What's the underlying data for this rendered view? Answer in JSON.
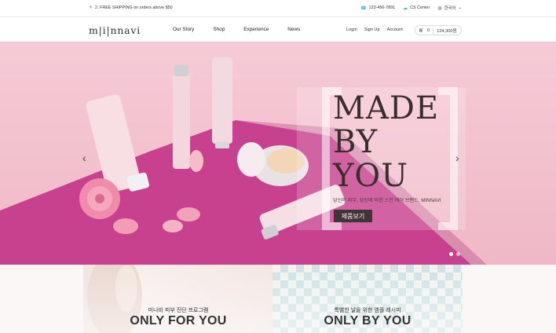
{
  "topbar": {
    "promo_icon": "airplane-icon",
    "promo_text": "2. FREE SHIPPING on orders above $50",
    "phone": "123-456-7891",
    "cs_center": "CS Center",
    "language": "한국어"
  },
  "header": {
    "logo": "m|i|nnavi",
    "nav": [
      "Our Story",
      "Shop",
      "Experience",
      "News"
    ],
    "account_links": [
      "Login",
      "Sign Up",
      "Account"
    ],
    "cart_count": "0",
    "cart_total": "124,300원"
  },
  "hero": {
    "headline_lines": [
      "MADE",
      "BY",
      "YOU"
    ],
    "tagline": "당신의 피부, 당신에 의한 스킨 케어 브랜드, MINNAVI",
    "button_label": "제품보기",
    "slide_count": 2,
    "active_slide": 1,
    "colors": {
      "background": "#f0b8c7",
      "table": "#c83c8c",
      "button": "#3f3536"
    }
  },
  "cards": [
    {
      "sub": "미나비 피부 진단 프로그램",
      "title": "ONLY FOR YOU"
    },
    {
      "sub": "특별한 날을 위한 앰플 레시피",
      "title": "ONLY BY YOU"
    }
  ]
}
